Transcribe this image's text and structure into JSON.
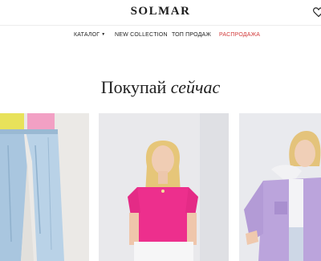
{
  "header": {
    "logo": "SOLMAR"
  },
  "nav": {
    "items": [
      {
        "label": "КАТАЛОГ",
        "has_dropdown": true
      },
      {
        "label": "NEW COLLECTION"
      },
      {
        "label": "ТОП ПРОДАЖ"
      },
      {
        "label": "РАСПРОДАЖА",
        "color": "#d23a3a"
      }
    ]
  },
  "hero": {
    "title_regular": "Покупай",
    "title_italic": "сейчас"
  },
  "products": [
    {
      "image": "jeans-photo"
    },
    {
      "image": "pink-tshirt-photo"
    },
    {
      "image": "lilac-jacket-photo"
    }
  ]
}
